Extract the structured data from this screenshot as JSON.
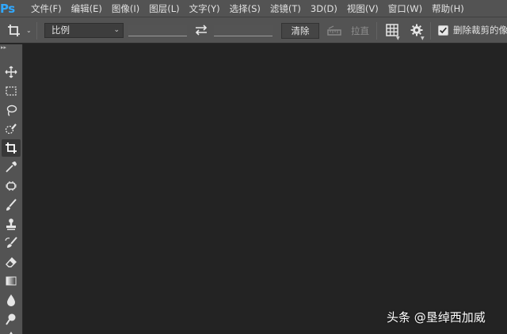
{
  "app": {
    "logo": "Ps"
  },
  "menu": [
    "文件(F)",
    "编辑(E)",
    "图像(I)",
    "图层(L)",
    "文字(Y)",
    "选择(S)",
    "滤镜(T)",
    "3D(D)",
    "视图(V)",
    "窗口(W)",
    "帮助(H)"
  ],
  "options": {
    "tool_icon": "crop-icon",
    "ratio_value": "比例",
    "clear_label": "清除",
    "straighten_label": "拉直",
    "delete_cropped_label": "删除裁剪的像",
    "delete_cropped_checked": true
  },
  "toolbar": {
    "tools": [
      "move-icon",
      "marquee-icon",
      "lasso-icon",
      "quick-selection-icon",
      "crop-icon",
      "eyedropper-icon",
      "spot-healing-icon",
      "brush-icon",
      "clone-stamp-icon",
      "history-brush-icon",
      "eraser-icon",
      "gradient-icon",
      "blur-icon",
      "dodge-icon",
      "pen-icon"
    ],
    "active_tool": "crop-icon"
  },
  "watermark": "头条 @垦绰西加威",
  "colors": {
    "menubar": "#535353",
    "canvas": "#232323",
    "logo": "#31a8ff"
  }
}
